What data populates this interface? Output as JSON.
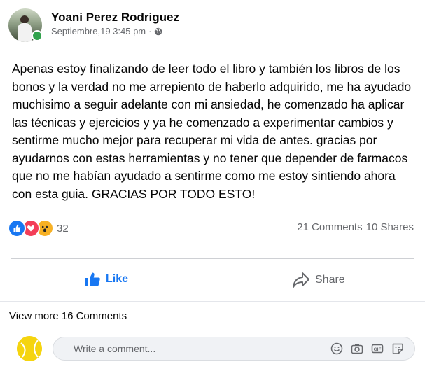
{
  "post": {
    "author": "Yoani Perez Rodriguez",
    "timestamp": "Septiembre,19 3:45 pm",
    "separator": "·",
    "privacy_icon": "globe-icon",
    "text": "Apenas estoy finalizando de leer todo el libro y también los libros de los bonos y la verdad no me arrepiento de haberlo adquirido, me ha ayudado muchisimo a seguir adelante con mi ansiedad, he comenzado ha aplicar las técnicas y ejercicios y ya he comenzado a experimentar cambios y sentirme mucho mejor para recuperar mi vida de antes. gracias por ayudarnos con estas herramientas y no tener que depender de farmacos que no me habían ayudado a sentirme como me estoy sintiendo ahora con esta guia. GRACIAS POR TODO ESTO!"
  },
  "reactions": {
    "icons": [
      "like-reaction-icon",
      "love-reaction-icon",
      "wow-reaction-icon"
    ],
    "count": "32",
    "comments": "21 Comments",
    "shares": "10 Shares"
  },
  "actions": {
    "like_label": "Like",
    "share_label": "Share"
  },
  "comments": {
    "view_more": "View more 16 Comments",
    "placeholder": "Write a comment..."
  },
  "colors": {
    "accent": "#1877f2",
    "online": "#31a24c",
    "muted": "#65676b"
  }
}
